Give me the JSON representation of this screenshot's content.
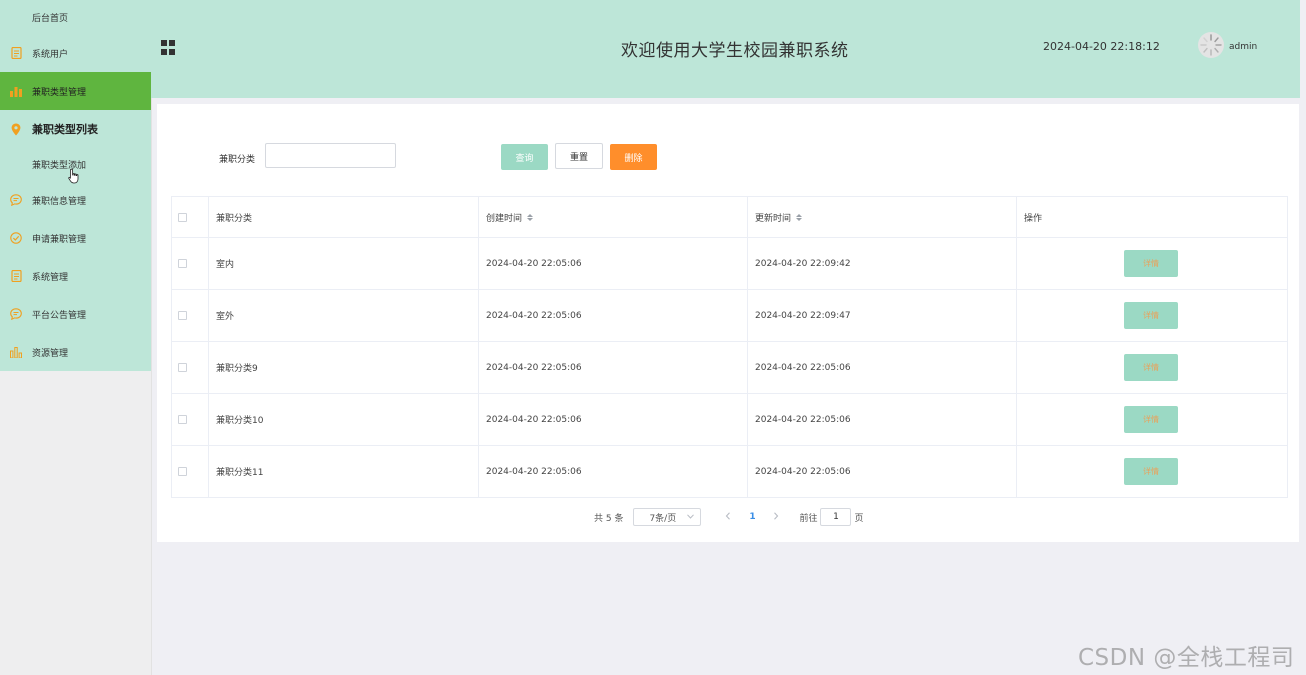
{
  "header": {
    "title": "欢迎使用大学生校园兼职系统",
    "datetime": "2024-04-20 22:18:12",
    "username": "admin"
  },
  "sidebar": {
    "items": [
      {
        "label": "后台首页",
        "icon": "none"
      },
      {
        "label": "系统用户",
        "icon": "document-icon"
      },
      {
        "label": "兼职类型管理",
        "icon": "bar-chart-icon"
      },
      {
        "label": "兼职类型列表",
        "icon": "location-pin-icon"
      },
      {
        "label": "兼职类型添加",
        "icon": "none"
      },
      {
        "label": "兼职信息管理",
        "icon": "chat-icon"
      },
      {
        "label": "申请兼职管理",
        "icon": "check-circle-icon"
      },
      {
        "label": "系统管理",
        "icon": "document-icon"
      },
      {
        "label": "平台公告管理",
        "icon": "chat-icon"
      },
      {
        "label": "资源管理",
        "icon": "bar-chart-icon"
      }
    ]
  },
  "search": {
    "label": "兼职分类",
    "value": "",
    "query_label": "查询",
    "reset_label": "重置",
    "delete_label": "删除"
  },
  "table": {
    "columns": [
      "兼职分类",
      "创建时间",
      "更新时间",
      "操作"
    ],
    "rows": [
      {
        "category": "室内",
        "created": "2024-04-20 22:05:06",
        "updated": "2024-04-20 22:09:42",
        "action": "详情"
      },
      {
        "category": "室外",
        "created": "2024-04-20 22:05:06",
        "updated": "2024-04-20 22:09:47",
        "action": "详情"
      },
      {
        "category": "兼职分类9",
        "created": "2024-04-20 22:05:06",
        "updated": "2024-04-20 22:05:06",
        "action": "详情"
      },
      {
        "category": "兼职分类10",
        "created": "2024-04-20 22:05:06",
        "updated": "2024-04-20 22:05:06",
        "action": "详情"
      },
      {
        "category": "兼职分类11",
        "created": "2024-04-20 22:05:06",
        "updated": "2024-04-20 22:05:06",
        "action": "详情"
      }
    ]
  },
  "pagination": {
    "total": "共 5 条",
    "page_size": "7条/页",
    "current_page": "1",
    "goto_prefix": "前往",
    "goto_value": "1",
    "goto_suffix": "页"
  },
  "watermark": "CSDN @全栈工程司",
  "colors": {
    "header_bg": "#bde6d8",
    "active_menu": "#5fb53f",
    "icon_orange": "#f0a020",
    "delete_btn": "#ff8e2b",
    "query_btn": "#9bd9c4"
  }
}
